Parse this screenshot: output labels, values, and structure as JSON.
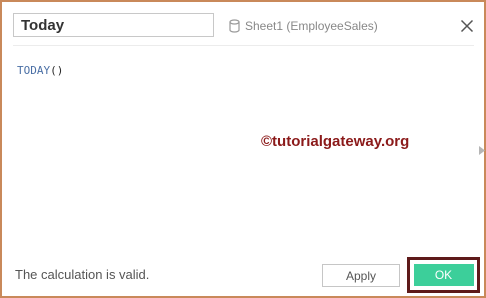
{
  "calculation": {
    "name_value": "Today"
  },
  "datasource": {
    "label": "Sheet1 (EmployeeSales)",
    "icon": "database-icon"
  },
  "header": {
    "close_icon": "close-icon"
  },
  "editor": {
    "function_name": "TODAY",
    "function_args": "()"
  },
  "watermark": {
    "text": "©tutorialgateway.org"
  },
  "footer": {
    "status": "The calculation is valid.",
    "apply_label": "Apply",
    "ok_label": "OK"
  },
  "colors": {
    "dialog_border": "#c9895a",
    "ok_button": "#3ccf9a",
    "ok_highlight": "#5e1a1a",
    "watermark": "#8b1a1a",
    "function_name": "#4a6fa5"
  }
}
